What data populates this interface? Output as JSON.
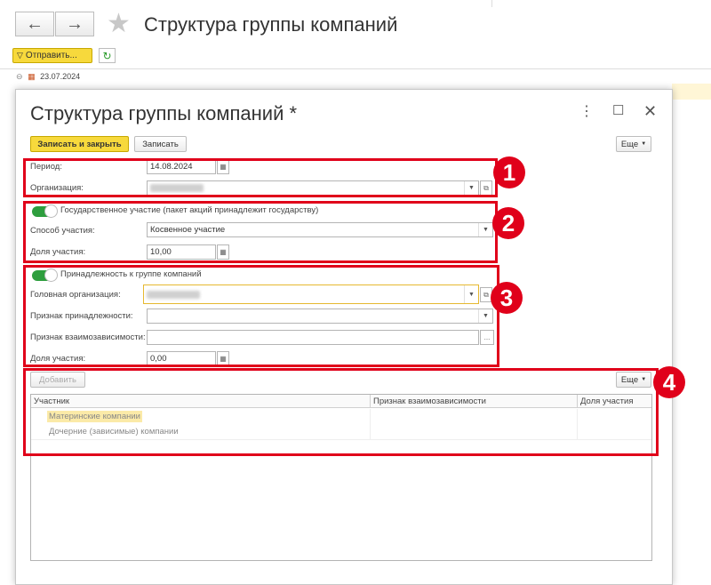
{
  "outer": {
    "back_icon": "arrow-left-icon",
    "forward_icon": "arrow-right-icon",
    "favorite_icon": "star-icon",
    "title": "Структура группы компаний",
    "send_label": "Отправить...",
    "refresh_icon": "refresh-icon",
    "tree_date": "23.07.2024"
  },
  "dialog": {
    "title": "Структура группы компаний *",
    "save_close_label": "Записать и закрыть",
    "save_label": "Записать",
    "more_label": "Еще",
    "section1": {
      "period_label": "Период:",
      "period_value": "14.08.2024",
      "org_label": "Организация:"
    },
    "section2": {
      "toggle_label": "Государственное участие (пакет акций принадлежит государству)",
      "method_label": "Способ участия:",
      "method_value": "Косвенное участие",
      "share_label": "Доля участия:",
      "share_value": "10,00"
    },
    "section3": {
      "toggle_label": "Принадлежность к группе компаний",
      "head_org_label": "Головная организация:",
      "belong_label": "Признак принадлежности:",
      "interdep_label": "Признак взаимозависимости:",
      "share_label": "Доля участия:",
      "share_value": "0,00"
    },
    "table": {
      "add_label": "Добавить",
      "more_label": "Еще",
      "columns": [
        "Участник",
        "Признак взаимозависимости",
        "Доля участия"
      ],
      "rows": [
        [
          "Материнские компании",
          "",
          ""
        ],
        [
          "Дочерние (зависимые) компании",
          "",
          ""
        ]
      ]
    }
  },
  "badges": [
    "1",
    "2",
    "3",
    "4"
  ],
  "colors": {
    "accent": "#f7d93c",
    "highlight_red": "#e0001a",
    "toggle_on": "#2e9e3e"
  }
}
